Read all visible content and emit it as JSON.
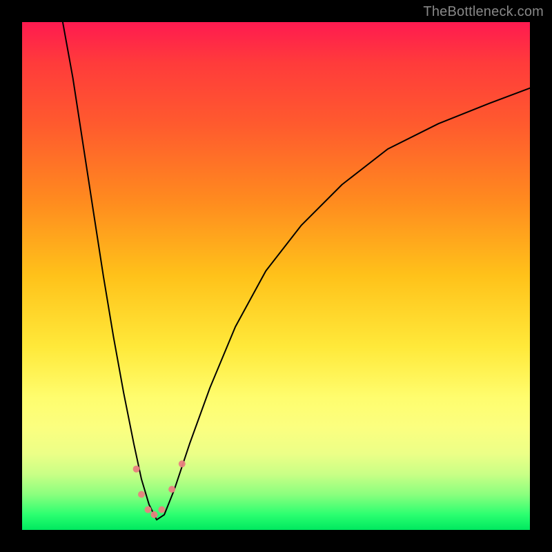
{
  "watermark": "TheBottleneck.com",
  "chart_data": {
    "type": "line",
    "title": "",
    "xlabel": "",
    "ylabel": "",
    "xlim": [
      0,
      100
    ],
    "ylim": [
      0,
      100
    ],
    "grid": false,
    "legend": false,
    "background_gradient": {
      "direction": "vertical",
      "stops": [
        {
          "pos": 0.0,
          "color": "#ff1a50"
        },
        {
          "pos": 0.5,
          "color": "#ffe93a"
        },
        {
          "pos": 1.0,
          "color": "#00e85f"
        }
      ]
    },
    "series": [
      {
        "name": "bottleneck-curve",
        "x": [
          8,
          10,
          12,
          14,
          16,
          18,
          20,
          22,
          23.5,
          25,
          26.5,
          28,
          30,
          33,
          37,
          42,
          48,
          55,
          63,
          72,
          82,
          92,
          100
        ],
        "y": [
          100,
          89,
          76,
          63,
          50,
          38,
          27,
          17,
          10,
          5,
          2,
          3,
          8,
          17,
          28,
          40,
          51,
          60,
          68,
          75,
          80,
          84,
          87
        ]
      }
    ],
    "markers": [
      {
        "x": 22.5,
        "y": 12,
        "r": 5,
        "color": "#e98080"
      },
      {
        "x": 23.5,
        "y": 7,
        "r": 5,
        "color": "#e98080"
      },
      {
        "x": 24.8,
        "y": 4,
        "r": 5,
        "color": "#e98080"
      },
      {
        "x": 26.0,
        "y": 3,
        "r": 5,
        "color": "#e98080"
      },
      {
        "x": 27.5,
        "y": 4,
        "r": 5,
        "color": "#e98080"
      },
      {
        "x": 29.5,
        "y": 8,
        "r": 5,
        "color": "#e98080"
      },
      {
        "x": 31.5,
        "y": 13,
        "r": 5,
        "color": "#e98080"
      }
    ],
    "minimum": {
      "x": 26,
      "y": 2
    }
  }
}
